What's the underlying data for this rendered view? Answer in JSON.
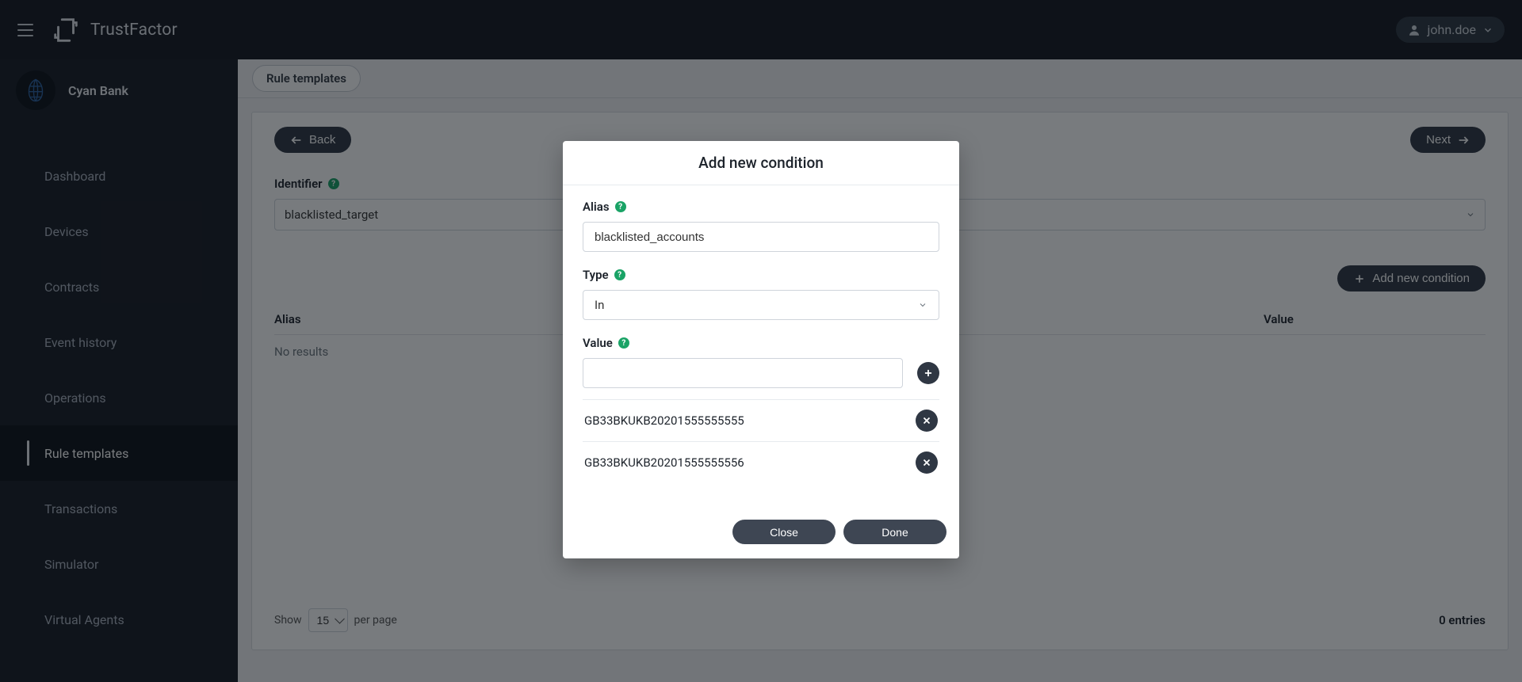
{
  "header": {
    "brand": "TrustFactor",
    "user": "john.doe"
  },
  "org": {
    "name": "Cyan Bank"
  },
  "sidebar": {
    "items": [
      {
        "label": "Dashboard"
      },
      {
        "label": "Devices"
      },
      {
        "label": "Contracts"
      },
      {
        "label": "Event history"
      },
      {
        "label": "Operations"
      },
      {
        "label": "Rule templates"
      },
      {
        "label": "Transactions"
      },
      {
        "label": "Simulator"
      },
      {
        "label": "Virtual Agents"
      }
    ],
    "activeIndex": 5
  },
  "breadcrumb": {
    "label": "Rule templates"
  },
  "actions": {
    "back": "Back",
    "next": "Next",
    "add_condition": "Add new condition"
  },
  "form": {
    "identifier_label": "Identifier",
    "identifier_value": "blacklisted_target"
  },
  "table": {
    "col_alias": "Alias",
    "col_value": "Value",
    "no_results": "No results"
  },
  "pager": {
    "show": "Show",
    "per_page": "per page",
    "size": "15",
    "entries": "0 entries"
  },
  "modal": {
    "title": "Add new condition",
    "alias_label": "Alias",
    "alias_value": "blacklisted_accounts",
    "type_label": "Type",
    "type_value": "In",
    "value_label": "Value",
    "value_input": "",
    "values": [
      "GB33BKUKB20201555555555",
      "GB33BKUKB20201555555556"
    ],
    "close": "Close",
    "done": "Done"
  }
}
